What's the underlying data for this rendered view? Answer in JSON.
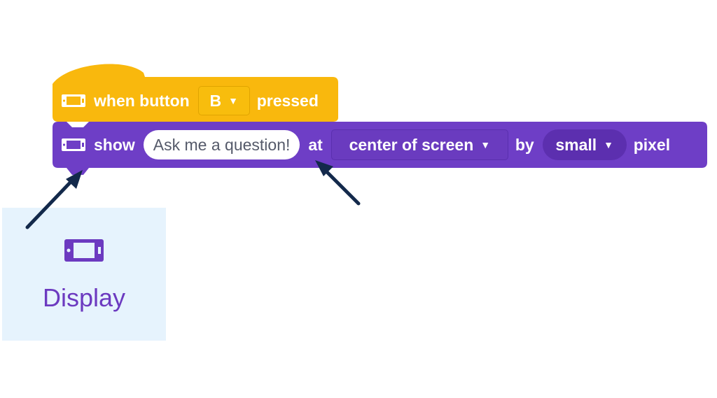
{
  "event_block": {
    "prefix": "when button",
    "button_value": "B",
    "suffix": "pressed",
    "color": "#f9b80d",
    "icon": "display-device-icon"
  },
  "show_block": {
    "prefix": "show",
    "text_value": "Ask me a question!",
    "at_label": "at",
    "position_value": "center of screen",
    "by_label": "by",
    "size_value": "small",
    "suffix": "pixel",
    "color": "#6e3ec6",
    "icon": "display-device-icon"
  },
  "category": {
    "label": "Display",
    "icon": "display-device-icon",
    "color": "#6c3ac0",
    "background": "#e6f3fd"
  },
  "annotations": {
    "arrow_color": "#13294b",
    "arrows": [
      "block-notch-arrow",
      "text-input-arrow"
    ]
  }
}
